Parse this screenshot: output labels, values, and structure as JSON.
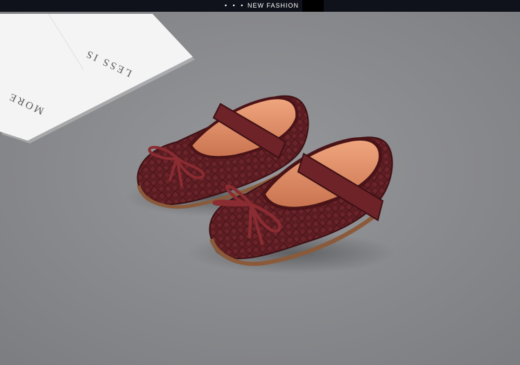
{
  "banner": {
    "dots": "• • •",
    "label": "NEW FASHION"
  },
  "card": {
    "line1": "LESS IS",
    "line2": "MORE"
  },
  "colors": {
    "background": "#8a8b8d",
    "banner": "#0f121a",
    "shoe": "#5e1d22",
    "lining": "#e3936a"
  }
}
